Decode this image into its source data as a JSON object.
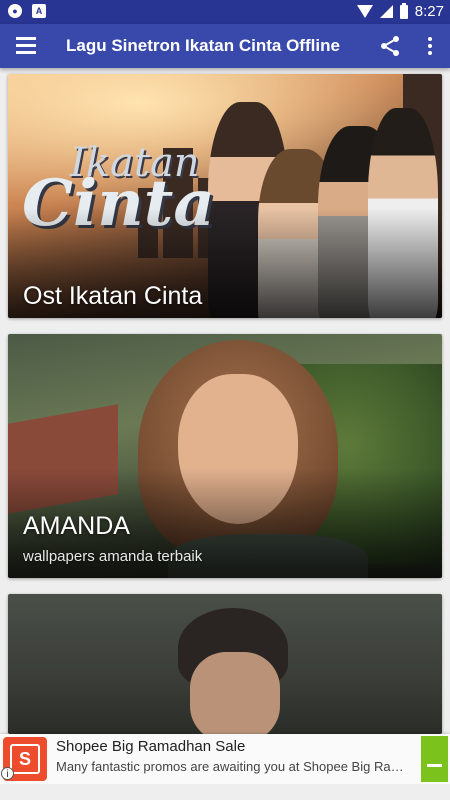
{
  "status_bar": {
    "time": "8:27",
    "icons": [
      "app-notification-icon",
      "android-notification-icon",
      "wifi-icon",
      "signal-icon",
      "battery-icon"
    ],
    "color": "#283593"
  },
  "app_bar": {
    "title": "Lagu Sinetron Ikatan Cinta Offline",
    "color": "#3949ab",
    "icons": [
      "menu-icon",
      "share-icon",
      "more-vert-icon"
    ]
  },
  "cards": [
    {
      "title": "Ost Ikatan Cinta",
      "subtitle": "",
      "logo_line1": "Ikatan",
      "logo_line2": "Cinta"
    },
    {
      "title": "AMANDA",
      "subtitle": "wallpapers amanda terbaik"
    },
    {
      "title": "",
      "subtitle": ""
    }
  ],
  "ad": {
    "title": "Shopee Big Ramadhan Sale",
    "description": "Many fantastic promos are awaiting you at Shopee Big Ramadhan Sale!",
    "logo_letter": "S",
    "info_glyph": "i",
    "brand_color": "#ee4d2d",
    "cta_color": "#7cc21c"
  }
}
